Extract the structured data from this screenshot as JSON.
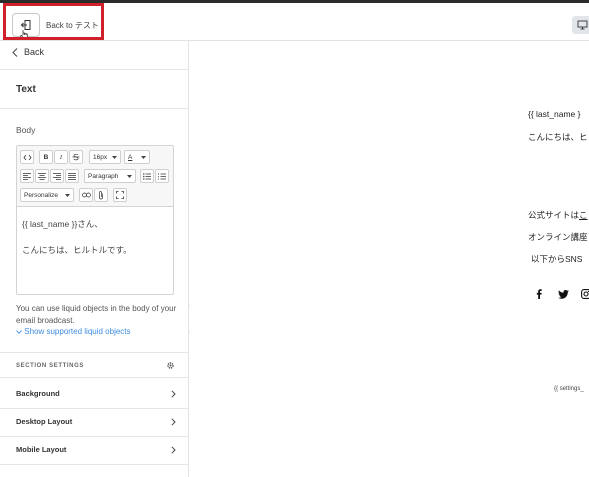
{
  "topbar": {
    "back_label": "Back to テスト"
  },
  "sidebar": {
    "back": "Back",
    "title": "Text",
    "body_label": "Body",
    "toolbar": {
      "font_size": "16px",
      "text_color_letter": "A",
      "paragraph": "Paragraph",
      "personalize": "Personalize",
      "bold": "B",
      "italic": "I"
    },
    "editor_lines": [
      "{{ last_name }}さん、",
      "こんにちは、ヒルトルです。"
    ],
    "hint": "You can use liquid objects in the body of your email broadcast.",
    "show_link": "Show supported liquid objects",
    "section_settings": "SECTION SETTINGS",
    "rows": [
      "Background",
      "Desktop Layout",
      "Mobile Layout"
    ]
  },
  "preview": {
    "line1": "{{ last_name }",
    "line2": "こんにちは、ヒ",
    "line3a": "公式サイトは",
    "line3b": "こ",
    "line4": "オンライン講座",
    "line5": "以下からSNS",
    "footer": "{{ settings_"
  },
  "colors": {
    "highlight": "#d0202a",
    "link": "#3d8de0",
    "monitor_bg": "#e2e6eb"
  }
}
